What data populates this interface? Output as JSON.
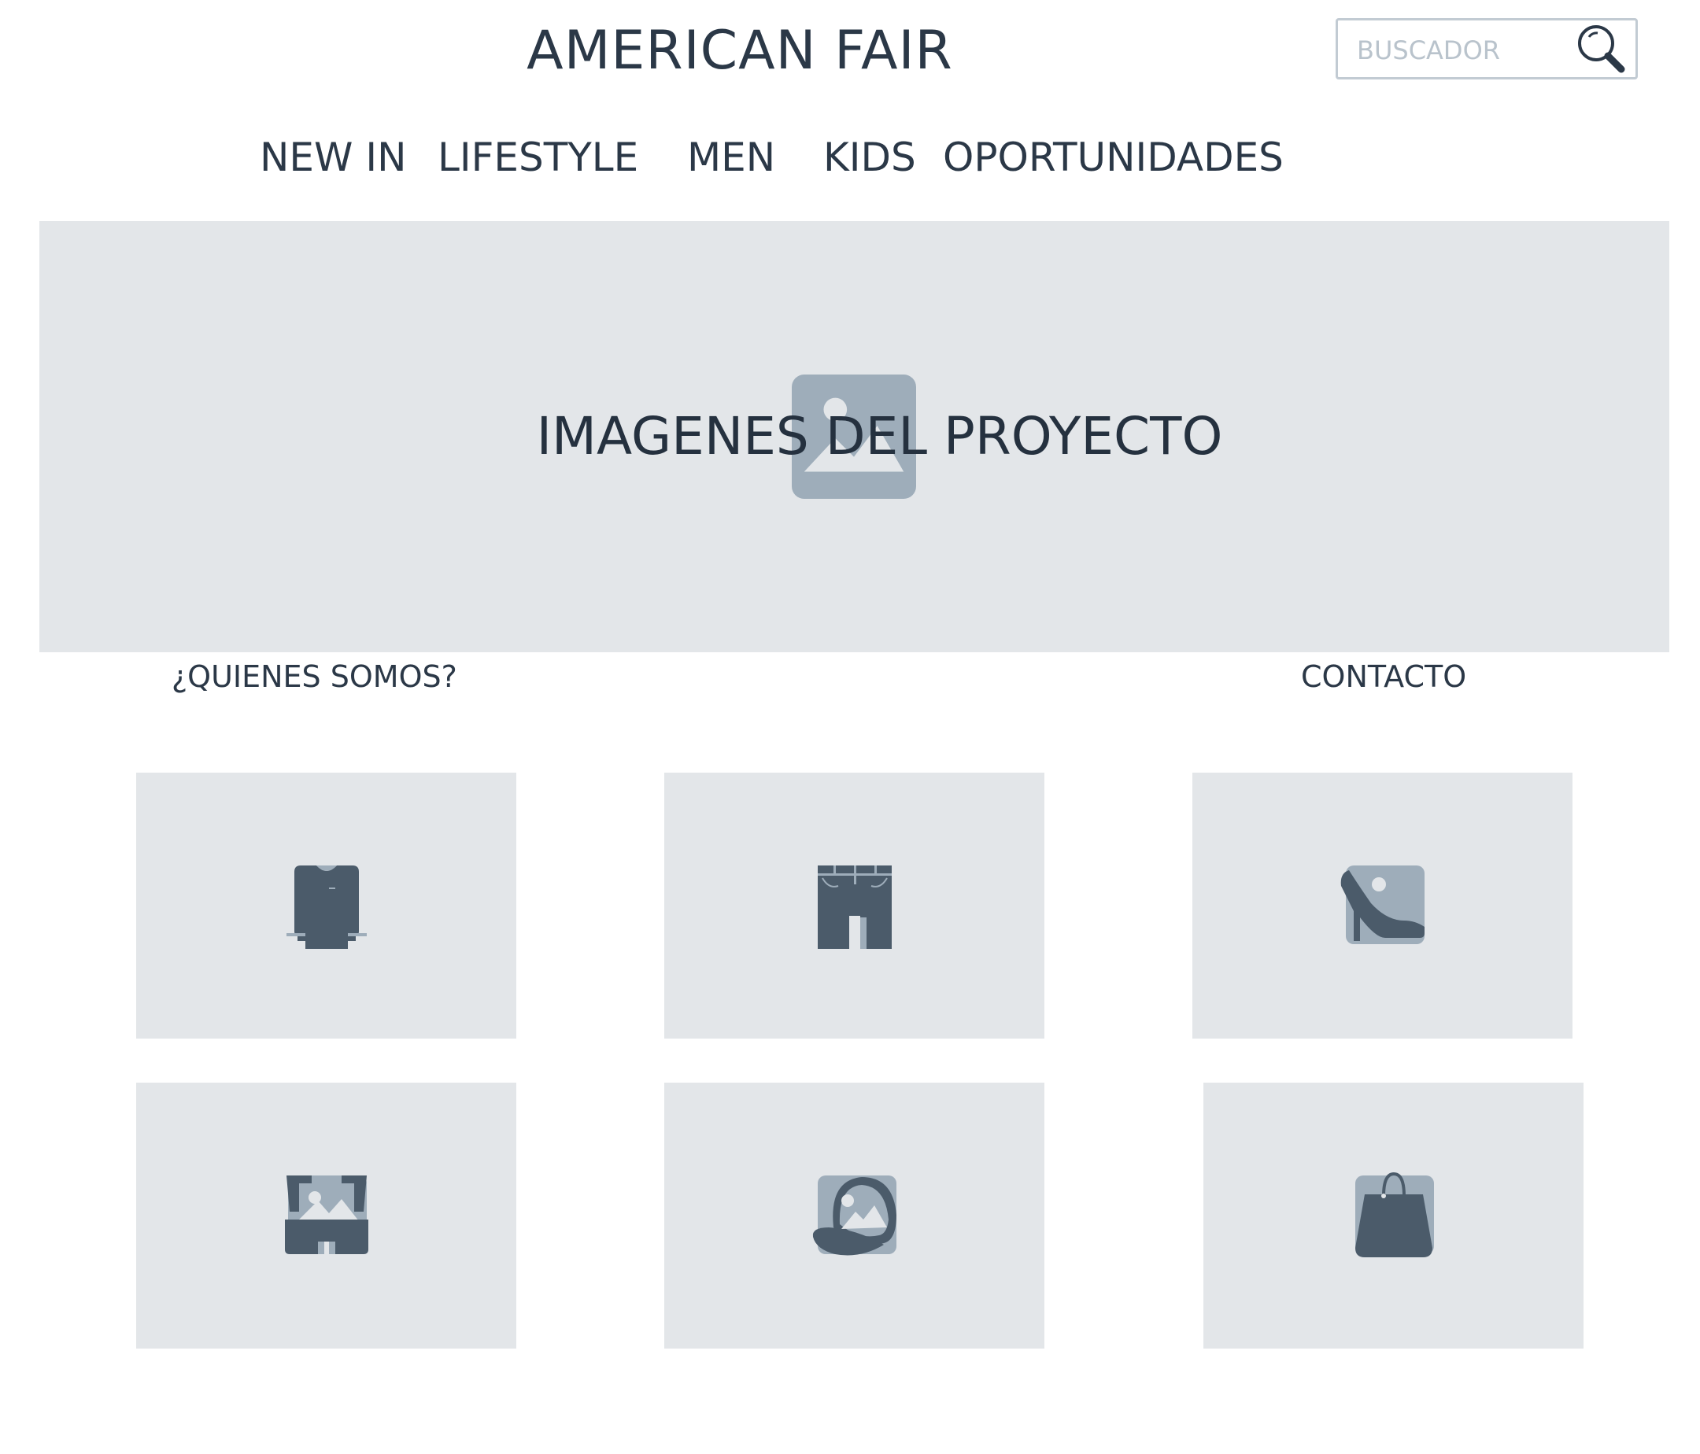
{
  "header": {
    "brand": "AMERICAN FAIR",
    "search": {
      "placeholder": "BUSCADOR"
    }
  },
  "nav": {
    "items": [
      "NEW IN",
      "LIFESTYLE",
      "MEN",
      "KIDS",
      "OPORTUNIDADES"
    ]
  },
  "hero": {
    "caption": "IMAGENES DEL PROYECTO",
    "icon": "image-placeholder-icon"
  },
  "links": {
    "about": "¿QUIENES SOMOS?",
    "contact": "CONTACTO"
  },
  "categories": [
    {
      "icon": "sweater-icon"
    },
    {
      "icon": "jeans-shorts-icon"
    },
    {
      "icon": "high-heel-icon"
    },
    {
      "icon": "swim-shorts-icon"
    },
    {
      "icon": "cap-icon"
    },
    {
      "icon": "handbag-icon"
    }
  ],
  "colors": {
    "text": "#2b3847",
    "placeholder_bg": "#e3e6e9",
    "icon_light": "#9eadba",
    "icon_dark": "#4b5b6a",
    "search_border": "#c2cbd3"
  }
}
